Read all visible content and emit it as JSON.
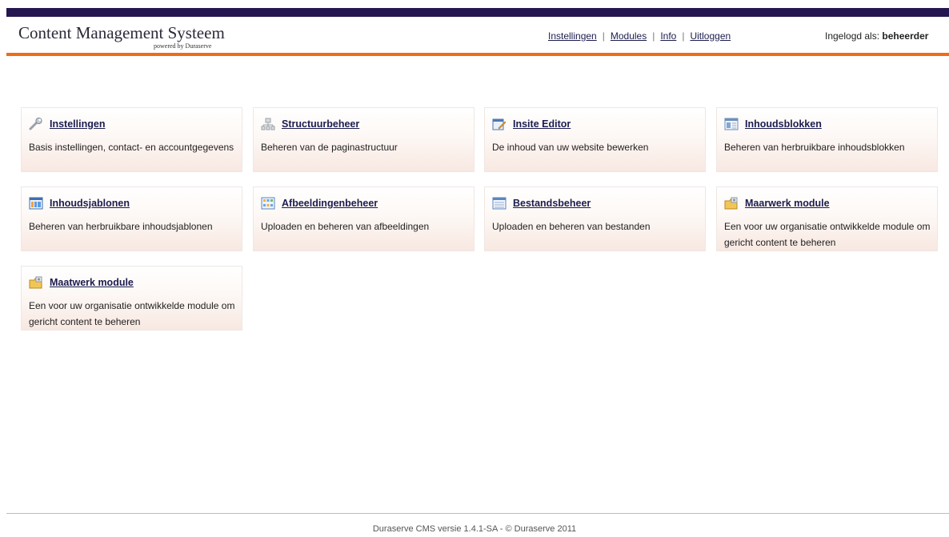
{
  "header": {
    "logo_title": "Content Management Systeem",
    "logo_subtitle": "powered by Duraserve",
    "nav": {
      "instellingen": "Instellingen",
      "modules": "Modules",
      "info": "Info",
      "uitloggen": "Uitloggen",
      "separator": "|"
    },
    "login_label": "Ingelogd als:",
    "login_user": "beheerder"
  },
  "colors": {
    "topbar": "#26164f",
    "accent_line": "#ee6b1a",
    "link": "#1c1c4e"
  },
  "modules": [
    {
      "icon": "wrench-icon",
      "title": "Instellingen",
      "description": "Basis instellingen, contact- en accountgegevens"
    },
    {
      "icon": "sitemap-icon",
      "title": "Structuurbeheer",
      "description": "Beheren van de paginastructuur"
    },
    {
      "icon": "edit-page-icon",
      "title": "Insite Editor",
      "description": "De inhoud van uw website bewerken"
    },
    {
      "icon": "content-block-icon",
      "title": "Inhoudsblokken",
      "description": "Beheren van herbruikbare inhoudsblokken"
    },
    {
      "icon": "template-icon",
      "title": "Inhoudsjablonen",
      "description": "Beheren van herbruikbare inhoudsjablonen"
    },
    {
      "icon": "image-gallery-icon",
      "title": "Afbeeldingenbeheer",
      "description": "Uploaden en beheren van afbeeldingen"
    },
    {
      "icon": "file-list-icon",
      "title": "Bestandsbeheer",
      "description": "Uploaden en beheren van bestanden"
    },
    {
      "icon": "custom-module-icon",
      "title": "Maarwerk module",
      "description": "Een voor uw organisatie ontwikkelde module om gericht content te beheren"
    },
    {
      "icon": "custom-module-icon",
      "title": "Maatwerk module",
      "description": "Een voor uw organisatie ontwikkelde module om gericht content te beheren"
    }
  ],
  "footer": {
    "text": "Duraserve CMS versie 1.4.1-SA - © Duraserve 2011"
  }
}
